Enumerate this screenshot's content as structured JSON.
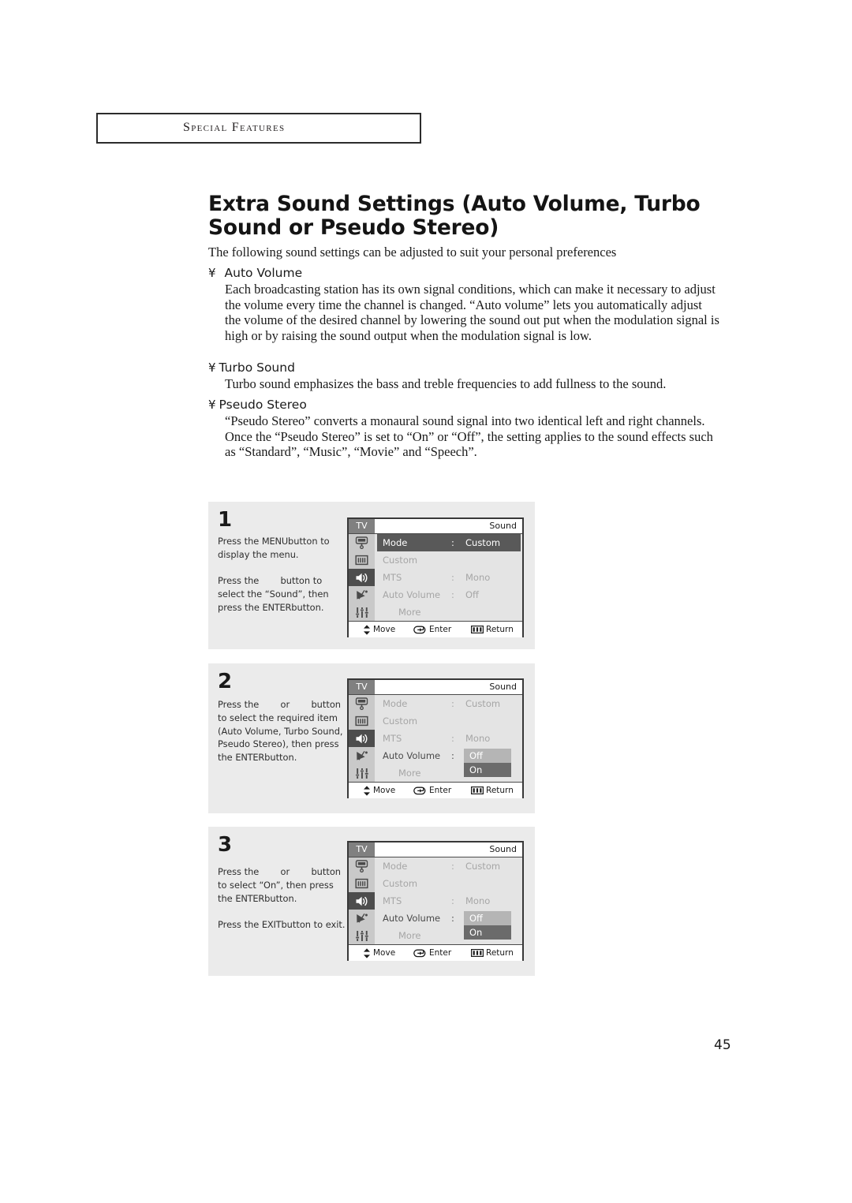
{
  "chapter": {
    "label": "Special Features"
  },
  "page": {
    "title": "Extra Sound Settings (Auto Volume, Turbo Sound or Pseudo Stereo)",
    "intro": "The following sound settings can be adjusted to suit your personal preferences",
    "number": "45"
  },
  "features": [
    {
      "bullet": "¥",
      "heading": "Auto Volume",
      "body": "Each broadcasting station has its own signal conditions, which can make it necessary to adjust the volume every time the channel is changed. “Auto volume” lets you automatically adjust the volume of the desired channel by lowering the sound out put when the modulation signal is high or by raising the sound output when the modulation signal is low."
    },
    {
      "bullet": "¥",
      "heading": "Turbo Sound",
      "body": "Turbo sound emphasizes the bass and treble frequencies to add fullness to the sound."
    },
    {
      "bullet": "¥",
      "heading": "Pseudo Stereo",
      "body": "“Pseudo Stereo” converts a monaural sound signal into two identical left and right channels. Once the “Pseudo Stereo” is set to “On” or “Off”, the setting applies to the sound effects such as “Standard”, “Music”, “Movie” and “Speech”."
    }
  ],
  "steps": [
    {
      "number": "1",
      "paragraphs": [
        [
          {
            "t": "Press the "
          },
          {
            "t": "MENU",
            "k": true
          },
          {
            "t": "button to display the menu."
          }
        ],
        [
          {
            "t": "Press the "
          },
          {
            "blank": true
          },
          {
            "t": " button to select the “Sound”, then press the "
          },
          {
            "t": "ENTER",
            "k": true
          },
          {
            "t": "button."
          }
        ]
      ],
      "osd": {
        "tv_tag": "TV",
        "title": "Sound",
        "rail_icons": [
          "tv-monitor-icon",
          "picture-icon",
          "speaker-icon",
          "satellite-dish-icon",
          "equalizer-icon"
        ],
        "selected_rail_index": 2,
        "rows": [
          {
            "label": "Mode",
            "colon": ":",
            "value": "Custom",
            "state": "highlight"
          },
          {
            "label": "Custom",
            "colon": "",
            "value": "",
            "state": "dim"
          },
          {
            "label": "MTS",
            "colon": ":",
            "value": "Mono",
            "state": "dim"
          },
          {
            "label": "Auto Volume",
            "colon": ":",
            "value": "Off",
            "state": "dim"
          },
          {
            "label": "More",
            "colon": "",
            "value": "",
            "state": "dim",
            "indent": true
          }
        ],
        "options": null,
        "footer": {
          "move": "Move",
          "enter": "Enter",
          "return": "Return"
        }
      }
    },
    {
      "number": "2",
      "paragraphs": [
        [
          {
            "t": "Press the "
          },
          {
            "blank": true
          },
          {
            "t": " or "
          },
          {
            "blank": true
          },
          {
            "t": " button to select the required item (Auto Volume, Turbo Sound, Pseudo Stereo), then press the "
          },
          {
            "t": "ENTER",
            "k": true
          },
          {
            "t": "button."
          }
        ]
      ],
      "osd": {
        "tv_tag": "TV",
        "title": "Sound",
        "rail_icons": [
          "tv-monitor-icon",
          "picture-icon",
          "speaker-icon",
          "satellite-dish-icon",
          "equalizer-icon"
        ],
        "selected_rail_index": 2,
        "rows": [
          {
            "label": "Mode",
            "colon": ":",
            "value": "Custom",
            "state": "dim"
          },
          {
            "label": "Custom",
            "colon": "",
            "value": "",
            "state": "dim"
          },
          {
            "label": "MTS",
            "colon": ":",
            "value": "Mono",
            "state": "dim"
          },
          {
            "label": "Auto Volume",
            "colon": ":",
            "value": "",
            "state": "bright"
          },
          {
            "label": "More",
            "colon": "",
            "value": "",
            "state": "dim",
            "indent": true
          }
        ],
        "options": {
          "off": "Off",
          "on": "On",
          "selected": "On"
        },
        "footer": {
          "move": "Move",
          "enter": "Enter",
          "return": "Return"
        }
      }
    },
    {
      "number": "3",
      "paragraphs": [
        [
          {
            "t": "Press the "
          },
          {
            "blank": true
          },
          {
            "t": " or "
          },
          {
            "blank": true
          },
          {
            "t": " button to select “On”, then press the "
          },
          {
            "t": "ENTER",
            "k": true
          },
          {
            "t": "button."
          }
        ],
        [
          {
            "t": "Press the "
          },
          {
            "t": "EXIT",
            "k": true
          },
          {
            "t": "button to exit."
          }
        ]
      ],
      "osd": {
        "tv_tag": "TV",
        "title": "Sound",
        "rail_icons": [
          "tv-monitor-icon",
          "picture-icon",
          "speaker-icon",
          "satellite-dish-icon",
          "equalizer-icon"
        ],
        "selected_rail_index": 2,
        "rows": [
          {
            "label": "Mode",
            "colon": ":",
            "value": "Custom",
            "state": "dim"
          },
          {
            "label": "Custom",
            "colon": "",
            "value": "",
            "state": "dim"
          },
          {
            "label": "MTS",
            "colon": ":",
            "value": "Mono",
            "state": "dim"
          },
          {
            "label": "Auto Volume",
            "colon": ":",
            "value": "",
            "state": "bright"
          },
          {
            "label": "More",
            "colon": "",
            "value": "",
            "state": "dim",
            "indent": true
          }
        ],
        "options": {
          "off": "Off",
          "on": "On",
          "selected": "On"
        },
        "footer": {
          "move": "Move",
          "enter": "Enter",
          "return": "Return"
        }
      }
    }
  ],
  "colors": {
    "panel_bg": "#ebebeb",
    "osd_body_bg": "#e4e4e4",
    "osd_rail_bg": "#c9c9c9",
    "osd_highlight": "#595959",
    "osd_tv_tag": "#808080",
    "option_off": "#b5b5b5",
    "option_on": "#6b6b6b",
    "text": "#1a1a1a"
  }
}
